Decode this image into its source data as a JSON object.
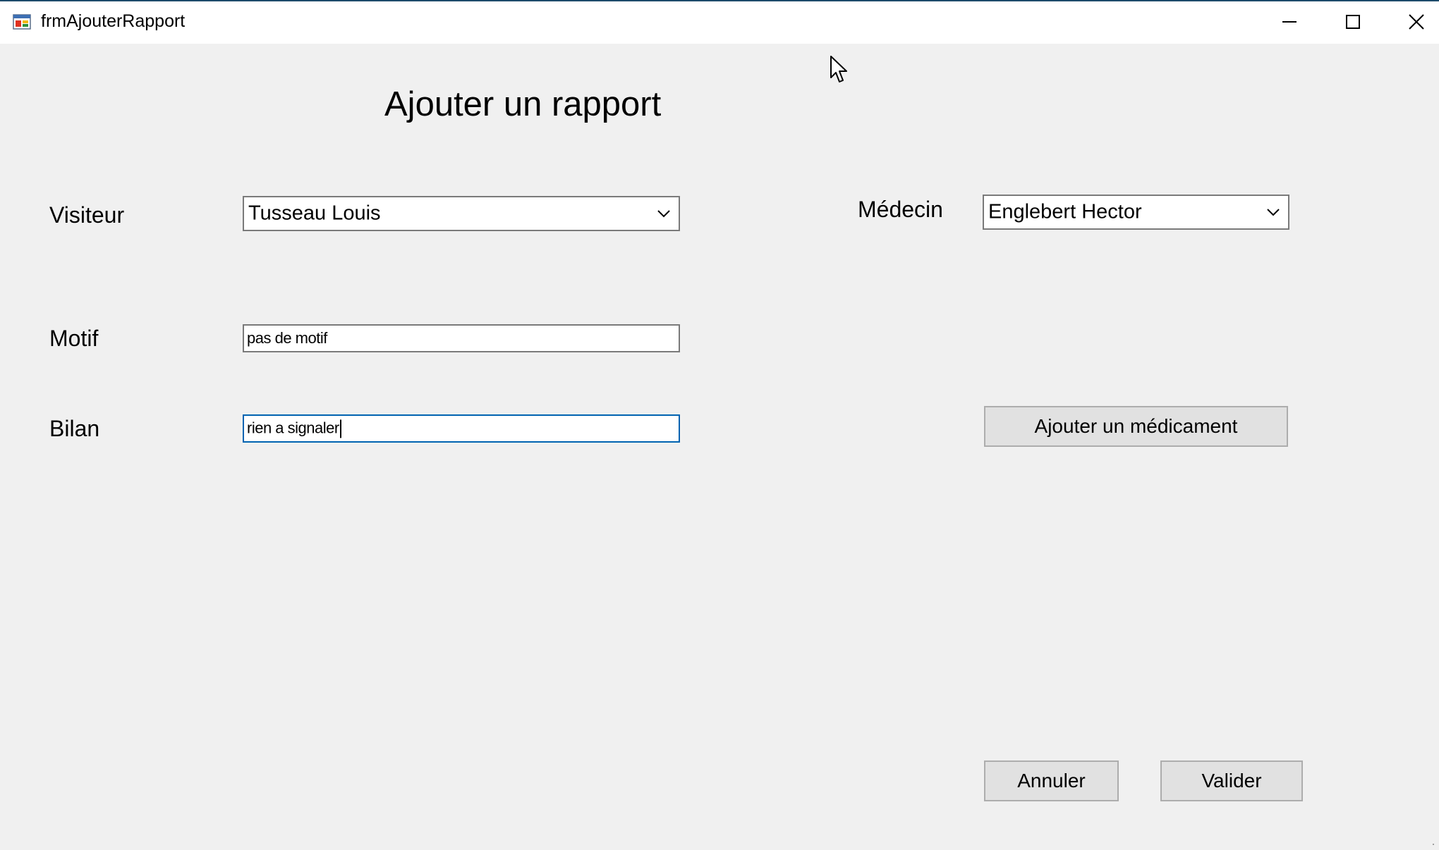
{
  "window": {
    "title": "frmAjouterRapport",
    "app_icon": "windows-form-icon",
    "controls": {
      "minimize_icon": "minimize-icon",
      "maximize_icon": "maximize-icon",
      "close_icon": "close-icon"
    }
  },
  "form": {
    "heading": "Ajouter un rapport",
    "visiteur": {
      "label": "Visiteur",
      "value": "Tusseau Louis"
    },
    "medecin": {
      "label": "Médecin",
      "value": "Englebert Hector"
    },
    "motif": {
      "label": "Motif",
      "value": "pas de motif"
    },
    "bilan": {
      "label": "Bilan",
      "value": "rien a signaler"
    },
    "buttons": {
      "add_medicament": "Ajouter un médicament",
      "cancel": "Annuler",
      "validate": "Valider"
    }
  },
  "colors": {
    "form_background": "#f0f0f0",
    "button_background": "#e1e1e1",
    "focus_border": "#0063b1"
  }
}
